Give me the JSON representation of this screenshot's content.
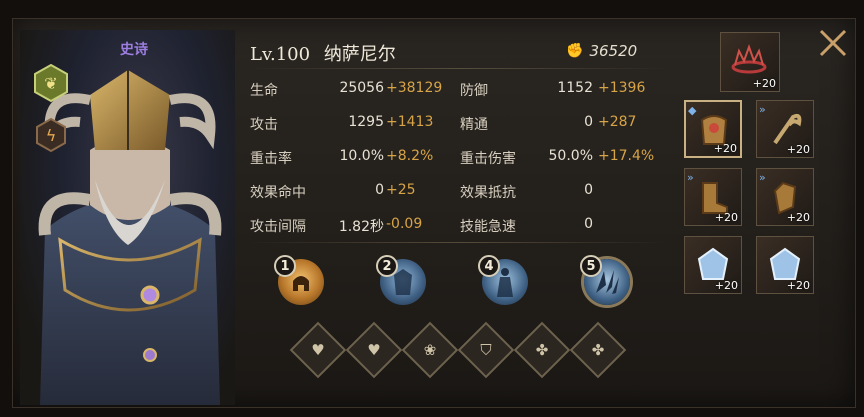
{
  "hero": {
    "rarity": "史诗",
    "level": "Lv.100",
    "name": "纳萨尼尔",
    "power": "36520"
  },
  "stats": [
    {
      "left_label": "生命",
      "left_base": "25056",
      "left_bonus": "+38129",
      "right_label": "防御",
      "right_base": "1152",
      "right_bonus": "+1396"
    },
    {
      "left_label": "攻击",
      "left_base": "1295",
      "left_bonus": "+1413",
      "right_label": "精通",
      "right_base": "0",
      "right_bonus": "+287"
    },
    {
      "left_label": "重击率",
      "left_base": "10.0%",
      "left_bonus": "+8.2%",
      "right_label": "重击伤害",
      "right_base": "50.0%",
      "right_bonus": "+17.4%"
    },
    {
      "left_label": "效果命中",
      "left_base": "0",
      "left_bonus": "+25",
      "right_label": "效果抵抗",
      "right_base": "0",
      "right_bonus": ""
    },
    {
      "left_label": "攻击间隔",
      "left_base": "1.82秒",
      "left_bonus": "-0.09",
      "right_label": "技能急速",
      "right_base": "0",
      "right_bonus": ""
    }
  ],
  "skills": [
    {
      "number": "1",
      "icon": "helmet-flame-icon"
    },
    {
      "number": "2",
      "icon": "frost-armor-icon"
    },
    {
      "number": "4",
      "icon": "frost-figure-icon"
    },
    {
      "number": "5",
      "icon": "frost-shards-icon"
    }
  ],
  "talents": [
    "heart-icon",
    "heart-hand-icon",
    "lotus-icon",
    "shield-heart-icon",
    "sprout-plus-icon",
    "sprout-plus-icon"
  ],
  "equipment": [
    {
      "name": "crown",
      "level": "+20"
    },
    {
      "name": "armor",
      "level": "+20"
    },
    {
      "name": "weapon",
      "level": "+20"
    },
    {
      "name": "boots",
      "level": "+20"
    },
    {
      "name": "gauntlet",
      "level": "+20"
    },
    {
      "name": "crystal-1",
      "level": "+20"
    },
    {
      "name": "crystal-2",
      "level": "+20"
    }
  ],
  "colors": {
    "bonus": "#d7a447",
    "rarity": "#9d7ee0",
    "frost": "#6f9ac4",
    "gold": "#c89a4a"
  }
}
